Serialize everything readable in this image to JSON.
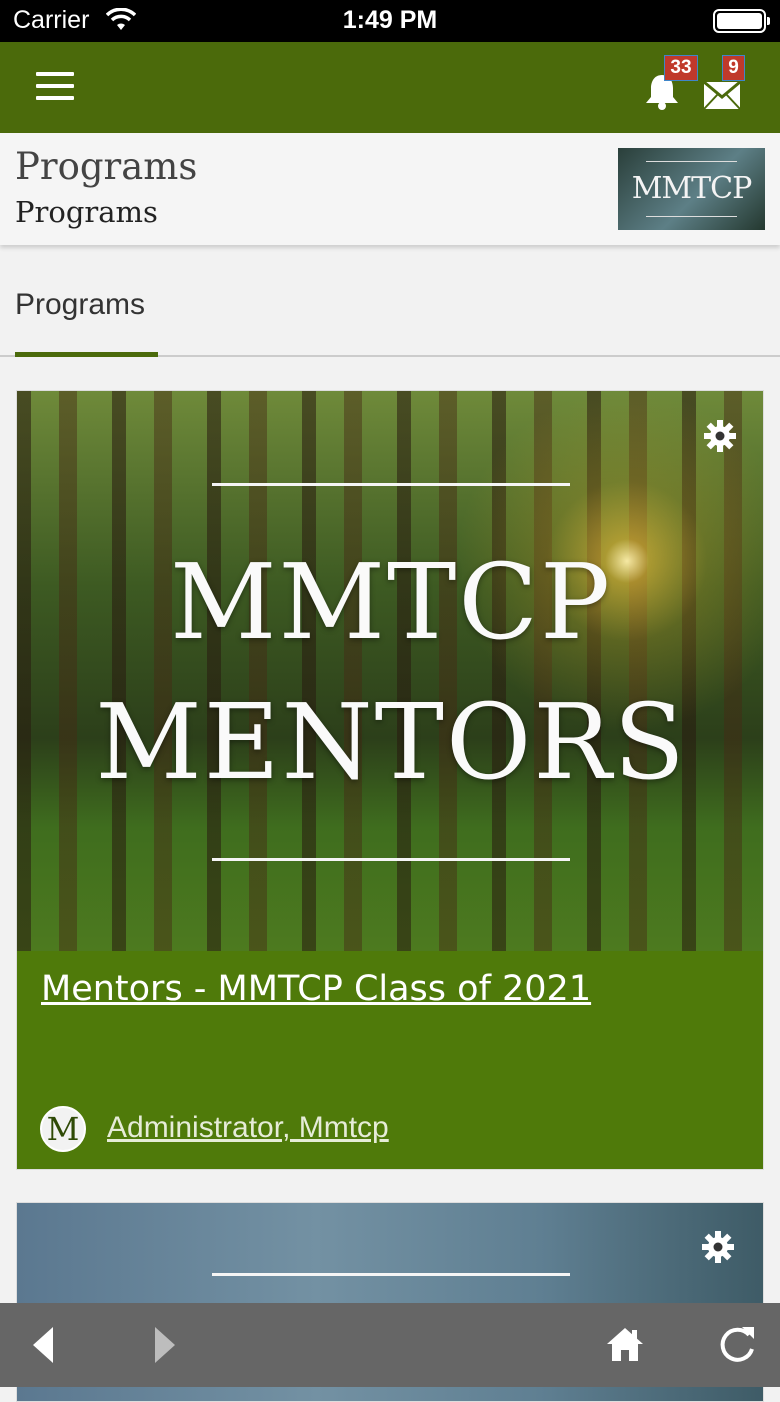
{
  "status_bar": {
    "carrier": "Carrier",
    "time": "1:49 PM"
  },
  "header": {
    "notification_count": "33",
    "message_count": "9"
  },
  "subheader": {
    "title": "Programs",
    "subtitle": "Programs",
    "logo_text": "MMTCP"
  },
  "tabs": [
    {
      "label": "Programs",
      "active": true
    }
  ],
  "programs": [
    {
      "image_lines": [
        "MMTCP",
        "MENTORS"
      ],
      "title": "Mentors - MMTCP Class of 2021",
      "owner_initial": "M",
      "owner": "Administrator, Mmtcp"
    }
  ],
  "icons": [
    "wifi-icon",
    "battery-icon",
    "menu-icon",
    "bell-icon",
    "mail-icon",
    "gear-icon",
    "back-icon",
    "forward-icon",
    "home-icon",
    "refresh-icon"
  ],
  "colors": {
    "brand_green": "#4b6a0b",
    "card_green": "#4f7a0a",
    "badge_red": "#c0392b",
    "toolbar_gray": "#666666"
  }
}
